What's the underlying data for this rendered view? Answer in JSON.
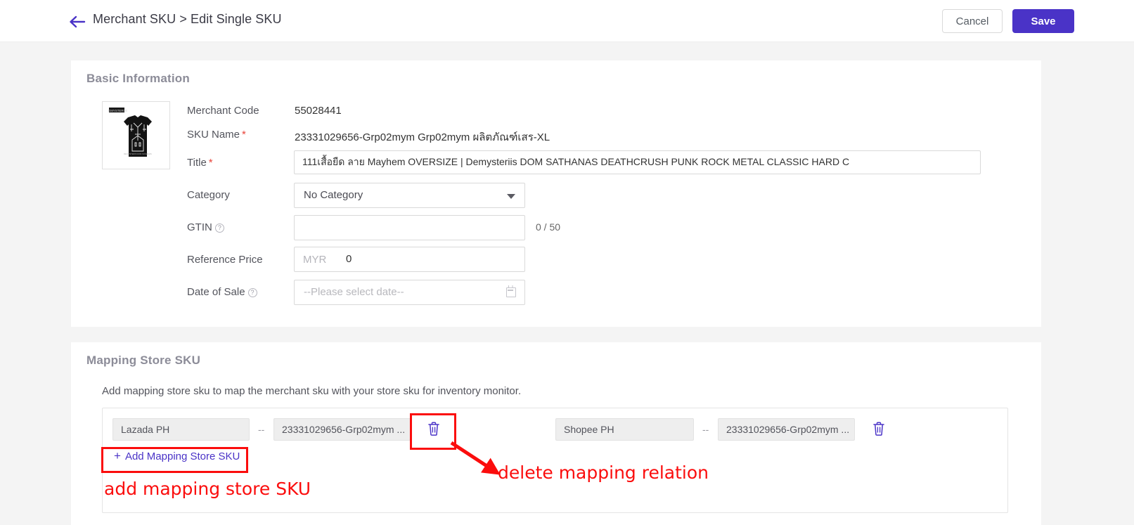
{
  "header": {
    "back_icon": "back-arrow-icon",
    "breadcrumb": "Merchant SKU > Edit Single SKU",
    "cancel_label": "Cancel",
    "save_label": "Save",
    "accent_color": "#4a33c7"
  },
  "basic": {
    "title": "Basic Information",
    "thumbnail_alt": "black t-shirt product photo",
    "fields": {
      "merchant_code_label": "Merchant Code",
      "merchant_code_value": "55028441",
      "sku_name_label": "SKU Name",
      "sku_name_required": "*",
      "sku_name_value": "23331029656-Grp02mym Grp02mym ผลิตภัณฑ์เสร-XL",
      "title_label": "Title",
      "title_required": "*",
      "title_value": "111เสื้อยืด ลาย Mayhem OVERSIZE | Demysteriis DOM SATHANAS DEATHCRUSH PUNK ROCK METAL CLASSIC HARD C",
      "category_label": "Category",
      "category_value": "No Category",
      "gtin_label": "GTIN",
      "gtin_value": "",
      "gtin_counter": "0 / 50",
      "reference_price_label": "Reference Price",
      "reference_price_currency": "MYR",
      "reference_price_value": "0",
      "date_of_sale_label": "Date of Sale",
      "date_of_sale_placeholder": "--Please select date--"
    }
  },
  "mapping": {
    "title": "Mapping Store SKU",
    "description": "Add mapping store sku to map the merchant sku with your store sku for inventory monitor.",
    "rows": [
      {
        "store": "Lazada PH",
        "separator": "--",
        "sku": "23331029656-Grp02mym ...",
        "delete_icon": "trash-icon"
      },
      {
        "store": "Shopee PH",
        "separator": "--",
        "sku": "23331029656-Grp02mym ...",
        "delete_icon": "trash-icon"
      }
    ],
    "add_link_plus": "+",
    "add_link_label": "Add Mapping Store SKU"
  },
  "annotations": {
    "color": "#fb0d0d",
    "add_note": "add mapping store SKU",
    "delete_note": "delete mapping relation"
  }
}
